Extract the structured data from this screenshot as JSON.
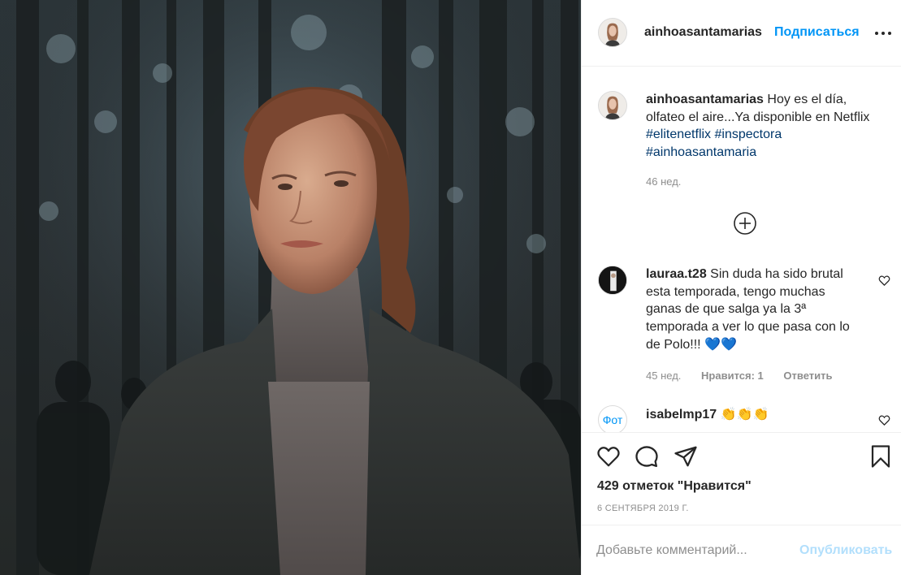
{
  "post": {
    "photo_alt": "",
    "header": {
      "username": "ainhoasantamarias",
      "separator": "•",
      "follow_label": "Подписаться"
    },
    "caption": {
      "username": "ainhoasantamarias",
      "text": "Hoy es el día, olfateo el aire...Ya disponible en Netflix",
      "hashtags": [
        "#elitenetflix",
        "#inspectora",
        "#ainhoasantamaria"
      ],
      "time": "46 нед."
    },
    "comments": [
      {
        "username": "lauraa.t28",
        "text": "Sin duda ha sido brutal esta temporada, tengo muchas ganas de que salga ya la 3ª temporada a ver lo que pasa con lo de Polo!!!",
        "emoji": "💙💙",
        "time": "45 нед.",
        "likes": "Нравится: 1",
        "reply_label": "Ответить"
      },
      {
        "username": "isabelmp17",
        "avatar_text": "Фот",
        "emoji": "👏👏👏"
      }
    ],
    "likes_text": "429 отметок \"Нравится\"",
    "date": "6 СЕНТЯБРЯ 2019 Г.",
    "add_comment": {
      "placeholder": "Добавьте комментарий...",
      "publish_label": "Опубликовать"
    },
    "icons": [
      "more-icon",
      "plus-circle-icon",
      "heart-icon",
      "comment-icon",
      "share-icon",
      "bookmark-icon"
    ],
    "colors": {
      "accent": "#0095f6",
      "publish_disabled": "#b2dffc",
      "hashtag": "#00376b",
      "muted": "#8e8e8e"
    }
  }
}
